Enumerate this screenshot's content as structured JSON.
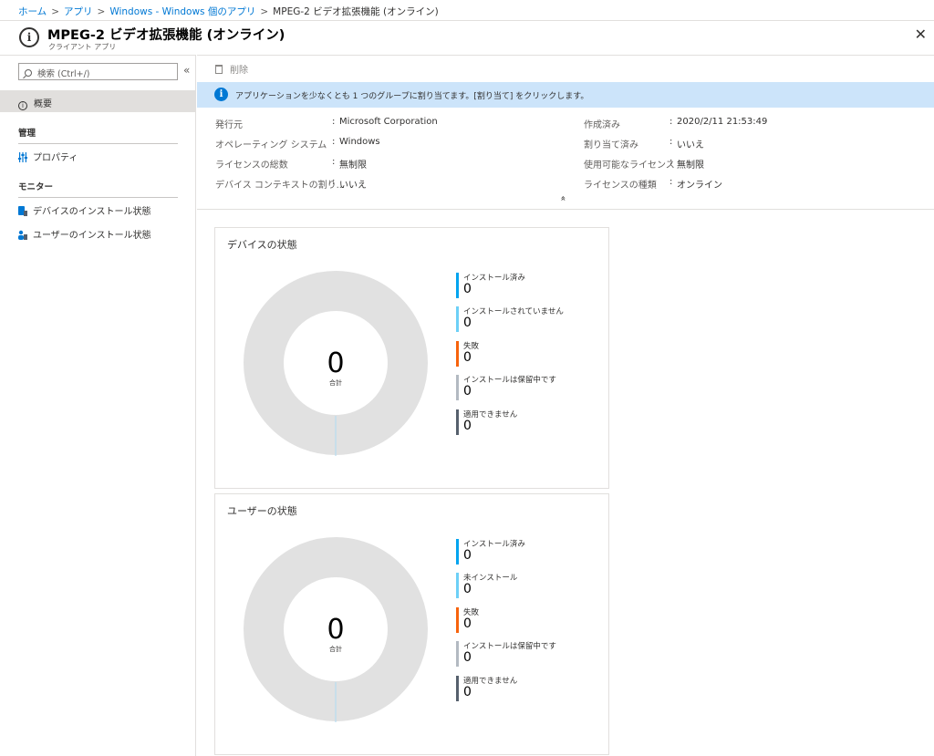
{
  "breadcrumb": {
    "items": [
      "ホーム",
      "アプリ",
      "Windows - Windows 個のアプリ"
    ],
    "current": "MPEG-2 ビデオ拡張機能 (オンライン)",
    "separator": ">"
  },
  "header": {
    "title": "MPEG-2 ビデオ拡張機能 (オンライン)",
    "subtitle": "クライアント アプリ",
    "close": "✕"
  },
  "sidebar": {
    "search_placeholder": "検索 (Ctrl+/)",
    "collapse": "«",
    "overview": "概要",
    "sections": [
      {
        "title": "管理",
        "items": [
          {
            "label": "プロパティ"
          }
        ]
      },
      {
        "title": "モニター",
        "items": [
          {
            "label": "デバイスのインストール状態"
          },
          {
            "label": "ユーザーのインストール状態"
          }
        ]
      }
    ]
  },
  "toolbar": {
    "delete": "削除"
  },
  "banner": {
    "text": "アプリケーションを少なくとも 1 つのグループに割り当てます。[割り当て] をクリックします。"
  },
  "properties": {
    "left": [
      {
        "key": "発行元",
        "value": "Microsoft Corporation"
      },
      {
        "key": "オペレーティング システム",
        "value": "Windows"
      },
      {
        "key": "ライセンスの総数",
        "value": "無制限"
      },
      {
        "key": "デバイス コンテキストの割り...",
        "value": "いいえ"
      }
    ],
    "right": [
      {
        "key": "作成済み",
        "value": "2020/2/11 21:53:49"
      },
      {
        "key": "割り当て済み",
        "value": "いいえ"
      },
      {
        "key": "使用可能なライセンス",
        "value": "無制限"
      },
      {
        "key": "ライセンスの種類",
        "value": "オンライン"
      }
    ],
    "colon": ":",
    "collapse_icon": "«"
  },
  "cards": [
    {
      "title": "デバイスの状態",
      "total": "0",
      "total_label": "合計",
      "legend": [
        {
          "label": "インストール済み",
          "value": "0",
          "color": "#00a4ef"
        },
        {
          "label": "インストールされていません",
          "value": "0",
          "color": "#6dd0f7"
        },
        {
          "label": "失敗",
          "value": "0",
          "color": "#f7630c"
        },
        {
          "label": "インストールは保留中です",
          "value": "0",
          "color": "#b3bac2"
        },
        {
          "label": "適用できません",
          "value": "0",
          "color": "#56606d"
        }
      ]
    },
    {
      "title": "ユーザーの状態",
      "total": "0",
      "total_label": "合計",
      "legend": [
        {
          "label": "インストール済み",
          "value": "0",
          "color": "#00a4ef"
        },
        {
          "label": "未インストール",
          "value": "0",
          "color": "#6dd0f7"
        },
        {
          "label": "失敗",
          "value": "0",
          "color": "#f7630c"
        },
        {
          "label": "インストールは保留中です",
          "value": "0",
          "color": "#b3bac2"
        },
        {
          "label": "適用できません",
          "value": "0",
          "color": "#56606d"
        }
      ]
    }
  ],
  "colors": {
    "accent": "#0078d4",
    "banner": "#cce4fa",
    "donut": "#e1e1e1"
  }
}
